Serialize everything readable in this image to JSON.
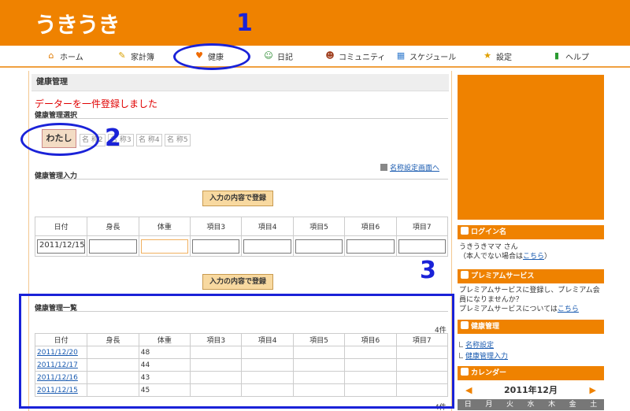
{
  "app": {
    "logo": "うきうき"
  },
  "nav": {
    "items": [
      {
        "label": "ホーム",
        "icon": "home-icon",
        "glyph": "⌂",
        "color": "#e07a00"
      },
      {
        "label": "家計簿",
        "icon": "pencil-icon",
        "glyph": "✎",
        "color": "#d8a000"
      },
      {
        "label": "健康",
        "icon": "heart-icon",
        "glyph": "♥",
        "color": "#ef6a00"
      },
      {
        "label": "日記",
        "icon": "person-icon",
        "glyph": "☺",
        "color": "#2a8a30"
      },
      {
        "label": "コミュニティ",
        "icon": "people-icon",
        "glyph": "☻",
        "color": "#a04020"
      },
      {
        "label": "スケジュール",
        "icon": "calendar-icon",
        "glyph": "▦",
        "color": "#3a80d0"
      },
      {
        "label": "設定",
        "icon": "star-icon",
        "glyph": "★",
        "color": "#e0a000"
      },
      {
        "label": "ヘルプ",
        "icon": "help-icon",
        "glyph": "▮",
        "color": "#2a9a30"
      }
    ]
  },
  "annotations": {
    "n1": "1",
    "n2": "2",
    "n3": "3"
  },
  "main": {
    "title": "健康管理",
    "success": "データーを一件登録しました",
    "select_label": "健康管理選択",
    "name_tabs": [
      "わたし",
      "名 称2",
      "名 称3",
      "名 称4",
      "名 称5"
    ],
    "settings_link": "名称設定画面へ",
    "input_label": "健康管理入力",
    "submit": "入力の内容で登録",
    "columns": [
      "日付",
      "身長",
      "体重",
      "項目3",
      "項目4",
      "項目5",
      "項目6",
      "項目7"
    ],
    "input_date": "2011/12/15",
    "list_label": "健康管理一覧",
    "count": "4件",
    "rows": [
      {
        "date": "2011/12/20",
        "weight": "48"
      },
      {
        "date": "2011/12/17",
        "weight": "44"
      },
      {
        "date": "2011/12/16",
        "weight": "43"
      },
      {
        "date": "2011/12/15",
        "weight": "45"
      }
    ]
  },
  "side": {
    "login": {
      "title": "ログイン名",
      "name": "うきうきママ さん",
      "not_you_prefix": "（本人でない場合は",
      "not_you_link": "こちら",
      "not_you_suffix": "）"
    },
    "premium": {
      "title": "プレミアムサービス",
      "text1": "プレミアムサービスに登録し、プレミアム会員になりませんか？",
      "text2_prefix": "プレミアムサービスについては",
      "text2_link": "こちら"
    },
    "health": {
      "title": "健康管理",
      "links": [
        "名称設定",
        "健康管理入力"
      ]
    },
    "calendar": {
      "title": "カレンダー",
      "month": "2011年12月",
      "days": [
        "日",
        "月",
        "火",
        "水",
        "木",
        "金",
        "土"
      ]
    }
  },
  "colors": {
    "brand": "#ef8200",
    "annotation": "#1a22d8",
    "error": "#e00000"
  }
}
